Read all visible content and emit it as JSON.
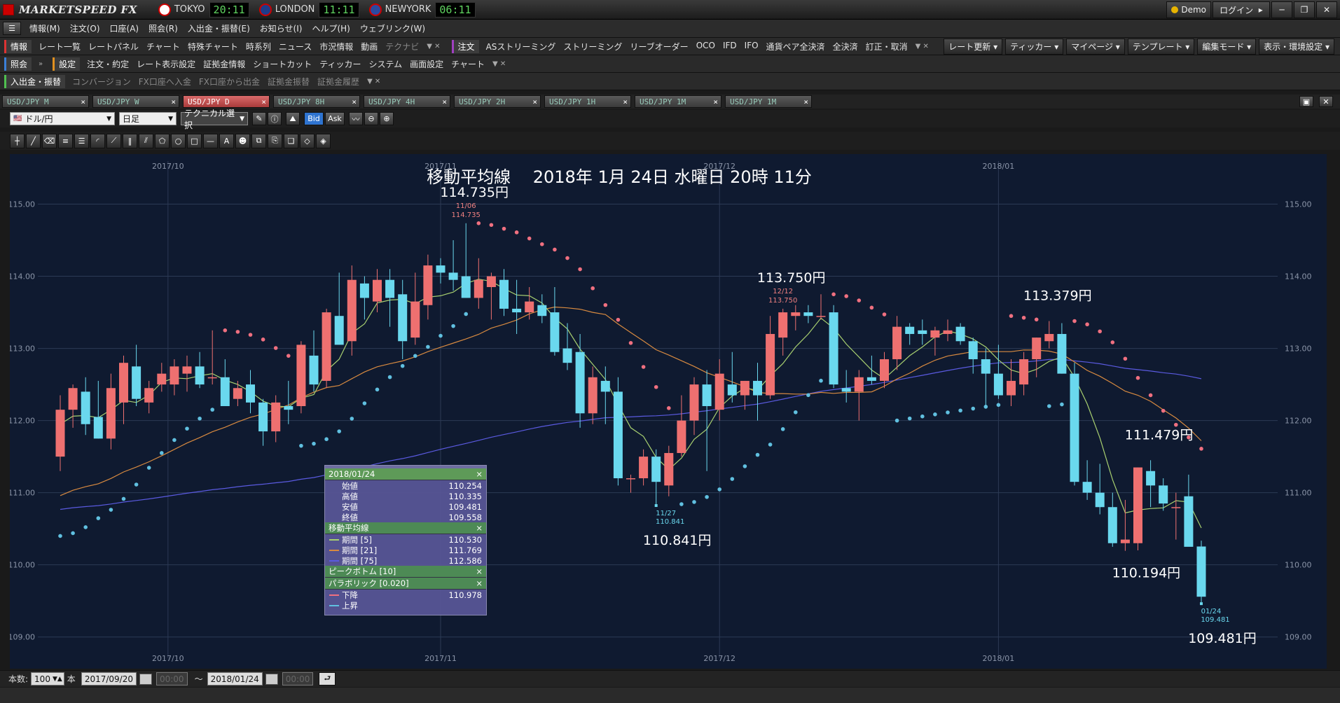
{
  "app": {
    "logo": "MARKETSPEED FX"
  },
  "clocks": [
    {
      "city": "TOKYO",
      "time": "20:11",
      "flag": "#ffffff"
    },
    {
      "city": "LONDON",
      "time": "11:11",
      "flag": "#1f3c8a"
    },
    {
      "city": "NEWYORK",
      "time": "06:11",
      "flag": "#2b4aa0"
    }
  ],
  "window": {
    "demo": "Demo",
    "login": "ログイン"
  },
  "menu": [
    "情報(M)",
    "注文(O)",
    "口座(A)",
    "照会(R)",
    "入出金・振替(E)",
    "お知らせ(I)",
    "ヘルプ(H)",
    "ウェブリンク(W)"
  ],
  "toolbar1": {
    "sec1": "情報",
    "items1": [
      "レート一覧",
      "レートパネル",
      "チャート",
      "特殊チャート",
      "時系列",
      "ニュース",
      "市況情報",
      "動画",
      "テクナビ"
    ],
    "sec2": "注文",
    "items2": [
      "ASストリーミング",
      "ストリーミング",
      "リーブオーダー",
      "OCO",
      "IFD",
      "IFO",
      "通貨ペア全決済",
      "全決済",
      "訂正・取消"
    ],
    "right": [
      "レート更新",
      "ティッカー",
      "マイページ",
      "テンプレート",
      "編集モード",
      "表示・環境設定"
    ]
  },
  "toolbar2": {
    "sec1": "照会",
    "sec2": "設定",
    "items2": [
      "注文・約定",
      "レート表示設定",
      "証拠金情報",
      "ショートカット",
      "ティッカー",
      "システム",
      "画面設定",
      "チャート"
    ]
  },
  "toolbar3": {
    "sec1": "入出金・振替",
    "items": [
      "コンバージョン",
      "FX口座へ入金",
      "FX口座から出金",
      "証拠金振替",
      "証拠金履歴"
    ]
  },
  "tabs": [
    "USD/JPY M",
    "USD/JPY W",
    "USD/JPY D",
    "USD/JPY 8H",
    "USD/JPY 4H",
    "USD/JPY 2H",
    "USD/JPY 1H",
    "USD/JPY 1M",
    "USD/JPY 1M"
  ],
  "active_tab": 2,
  "chart_toolbar": {
    "pair": "ドル/円",
    "period": "日足",
    "technical": "テクニカル選択",
    "bid": "Bid",
    "ask": "Ask"
  },
  "bottom": {
    "count_label": "本数:",
    "count": "100",
    "unit": "本",
    "from": "2017/09/20",
    "time_from": "00:00",
    "tilde": "～",
    "to": "2018/01/24",
    "time_to": "00:00"
  },
  "popup": {
    "date": "2018/01/24",
    "ohlc": [
      {
        "k": "始値",
        "v": "110.254"
      },
      {
        "k": "高値",
        "v": "110.335"
      },
      {
        "k": "安値",
        "v": "109.481"
      },
      {
        "k": "終値",
        "v": "109.558"
      }
    ],
    "ma_title": "移動平均線",
    "ma": [
      {
        "k": "期間 [5]",
        "v": "110.530",
        "c": "#a8d070"
      },
      {
        "k": "期間 [21]",
        "v": "111.769",
        "c": "#d88a40"
      },
      {
        "k": "期間 [75]",
        "v": "112.586",
        "c": "#5a5ae0"
      }
    ],
    "peak_title": "ピークボトム [10]",
    "para_title": "パラボリック [0.020]",
    "para": [
      {
        "k": "下降",
        "v": "110.978",
        "c": "#f07080"
      },
      {
        "k": "上昇",
        "v": "",
        "c": "#60c0e0"
      }
    ]
  },
  "chart_data": {
    "type": "candlestick",
    "title": "移動平均線　 2018年 1月 24日 水曜日 20時 11分",
    "y_ticks": [
      "115.00",
      "114.00",
      "113.00",
      "112.00",
      "111.00",
      "110.00",
      "109.00"
    ],
    "x_months": [
      "2017/10",
      "2017/11",
      "2017/12",
      "2018/01"
    ],
    "ylim": [
      108.9,
      115.5
    ],
    "colors": {
      "up": "#ee7070",
      "down": "#6ad8ee",
      "ma5": "#a8d070",
      "ma21": "#d88a40",
      "ma75": "#5a5ae0",
      "sar_down": "#f07080",
      "sar_up": "#60c0e0"
    },
    "ohlc": [
      [
        111.5,
        112.35,
        111.3,
        112.15
      ],
      [
        112.15,
        112.5,
        111.9,
        112.45
      ],
      [
        112.4,
        112.6,
        111.8,
        111.95
      ],
      [
        112.05,
        112.55,
        111.75,
        111.75
      ],
      [
        111.75,
        112.65,
        111.6,
        112.45
      ],
      [
        112.25,
        112.9,
        111.95,
        112.8
      ],
      [
        112.75,
        113.05,
        112.2,
        112.3
      ],
      [
        112.25,
        112.55,
        112.1,
        112.45
      ],
      [
        112.5,
        112.8,
        112.4,
        112.65
      ],
      [
        112.5,
        112.85,
        112.35,
        112.75
      ],
      [
        112.65,
        112.9,
        112.4,
        112.75
      ],
      [
        112.75,
        112.95,
        112.45,
        112.5
      ],
      [
        112.6,
        113.25,
        112.5,
        112.6
      ],
      [
        112.6,
        112.85,
        112.25,
        112.2
      ],
      [
        112.3,
        112.55,
        112.2,
        112.45
      ],
      [
        112.5,
        112.7,
        112.1,
        112.25
      ],
      [
        112.25,
        112.3,
        111.65,
        111.85
      ],
      [
        111.85,
        112.35,
        111.7,
        112.25
      ],
      [
        112.2,
        112.55,
        111.95,
        112.15
      ],
      [
        112.2,
        113.1,
        112.1,
        113.05
      ],
      [
        112.9,
        113.25,
        112.4,
        112.5
      ],
      [
        112.55,
        113.55,
        112.45,
        113.5
      ],
      [
        113.45,
        114.05,
        113.3,
        113.05
      ],
      [
        113.1,
        114.15,
        112.9,
        113.95
      ],
      [
        113.9,
        114.0,
        113.4,
        113.7
      ],
      [
        113.65,
        114.1,
        113.5,
        113.95
      ],
      [
        113.95,
        114.1,
        113.3,
        113.7
      ],
      [
        113.75,
        113.95,
        112.85,
        113.1
      ],
      [
        113.15,
        114.05,
        113.05,
        113.65
      ],
      [
        113.6,
        114.3,
        113.4,
        114.15
      ],
      [
        114.15,
        114.25,
        113.9,
        114.05
      ],
      [
        114.05,
        114.5,
        113.8,
        113.95
      ],
      [
        114.0,
        114.735,
        113.7,
        113.7
      ],
      [
        113.7,
        114.25,
        113.55,
        113.95
      ],
      [
        113.85,
        114.05,
        113.4,
        114.0
      ],
      [
        113.95,
        114.1,
        113.45,
        113.55
      ],
      [
        113.55,
        113.95,
        113.2,
        113.5
      ],
      [
        113.5,
        113.85,
        113.4,
        113.65
      ],
      [
        113.6,
        113.75,
        113.35,
        113.45
      ],
      [
        113.5,
        113.85,
        112.9,
        112.95
      ],
      [
        113.0,
        113.35,
        112.7,
        112.8
      ],
      [
        112.95,
        113.2,
        111.9,
        112.1
      ],
      [
        112.1,
        112.75,
        111.95,
        112.6
      ],
      [
        112.55,
        112.75,
        111.95,
        112.4
      ],
      [
        112.4,
        112.6,
        111.1,
        111.2
      ],
      [
        111.2,
        111.25,
        111.0,
        111.2
      ],
      [
        111.2,
        111.6,
        111.1,
        111.5
      ],
      [
        111.5,
        111.6,
        110.841,
        111.15
      ],
      [
        111.1,
        111.65,
        110.95,
        111.55
      ],
      [
        111.55,
        112.35,
        111.5,
        112.0
      ],
      [
        112.0,
        112.6,
        111.8,
        112.5
      ],
      [
        112.5,
        112.7,
        111.3,
        112.2
      ],
      [
        112.15,
        112.85,
        112.0,
        112.65
      ],
      [
        112.5,
        112.95,
        112.25,
        112.35
      ],
      [
        112.35,
        112.55,
        112.15,
        112.55
      ],
      [
        112.55,
        112.8,
        112.0,
        112.35
      ],
      [
        112.35,
        113.45,
        112.3,
        113.2
      ],
      [
        113.15,
        113.55,
        112.9,
        113.5
      ],
      [
        113.45,
        113.6,
        113.25,
        113.5
      ],
      [
        113.5,
        113.6,
        113.35,
        113.45
      ],
      [
        113.45,
        113.75,
        113.4,
        113.45
      ],
      [
        113.5,
        113.6,
        112.45,
        112.5
      ],
      [
        112.45,
        112.7,
        112.25,
        112.4
      ],
      [
        112.4,
        112.7,
        112.0,
        112.6
      ],
      [
        112.6,
        112.9,
        112.5,
        112.55
      ],
      [
        112.55,
        112.95,
        112.45,
        112.85
      ],
      [
        112.85,
        113.45,
        112.7,
        113.3
      ],
      [
        113.3,
        113.35,
        113.05,
        113.2
      ],
      [
        113.25,
        113.4,
        113.05,
        113.2
      ],
      [
        113.15,
        113.3,
        112.9,
        113.25
      ],
      [
        113.2,
        113.4,
        113.1,
        113.25
      ],
      [
        113.3,
        113.35,
        113.05,
        113.1
      ],
      [
        113.1,
        113.15,
        112.65,
        112.85
      ],
      [
        112.85,
        113.0,
        112.2,
        112.65
      ],
      [
        112.65,
        113.05,
        112.3,
        112.35
      ],
      [
        112.35,
        112.85,
        112.2,
        112.55
      ],
      [
        112.5,
        112.95,
        112.35,
        112.85
      ],
      [
        112.85,
        113.15,
        112.6,
        113.15
      ],
      [
        113.1,
        113.379,
        113.0,
        113.2
      ],
      [
        113.2,
        113.35,
        112.65,
        112.65
      ],
      [
        112.65,
        112.8,
        111.1,
        111.15
      ],
      [
        111.15,
        111.45,
        110.9,
        111.0
      ],
      [
        111.0,
        111.4,
        110.7,
        110.8
      ],
      [
        110.8,
        111.0,
        110.25,
        110.3
      ],
      [
        110.3,
        110.9,
        110.194,
        110.35
      ],
      [
        110.3,
        111.35,
        110.2,
        111.35
      ],
      [
        111.3,
        111.45,
        110.8,
        111.1
      ],
      [
        111.1,
        111.2,
        110.75,
        110.85
      ],
      [
        110.8,
        111.0,
        110.35,
        110.8
      ],
      [
        110.95,
        111.25,
        110.3,
        110.25
      ],
      [
        110.254,
        110.335,
        109.481,
        109.558
      ]
    ],
    "annotations": [
      {
        "idx": 32,
        "date": "11/06",
        "val": "114.735",
        "label": "114.735円",
        "pos": "high"
      },
      {
        "idx": 47,
        "date": "11/27",
        "val": "110.841",
        "label": "110.841円",
        "pos": "low"
      },
      {
        "idx": 57,
        "date": "12/12",
        "val": "113.750",
        "label": "113.750円",
        "pos": "high"
      },
      {
        "idx": 78,
        "date": "",
        "val": "",
        "label": "113.379円",
        "pos": "high"
      },
      {
        "idx": 86,
        "date": "",
        "val": "",
        "label": "111.479円",
        "pos": "high"
      },
      {
        "idx": 84,
        "date": "",
        "val": "",
        "label": "110.194円",
        "pos": "low"
      },
      {
        "idx": 90,
        "date": "01/24",
        "val": "109.481",
        "label": "109.481円",
        "pos": "low"
      }
    ]
  }
}
